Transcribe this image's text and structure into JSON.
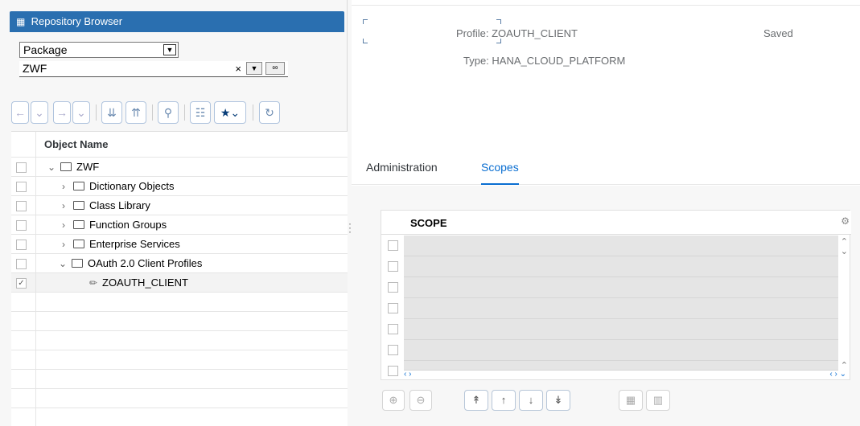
{
  "repo": {
    "title": "Repository Browser",
    "object_type": "Package",
    "package_value": "ZWF"
  },
  "tree": {
    "column_header": "Object Name",
    "rows": [
      {
        "label": "ZWF",
        "checked": false
      },
      {
        "label": "Dictionary Objects",
        "checked": false
      },
      {
        "label": "Class Library",
        "checked": false
      },
      {
        "label": "Function Groups",
        "checked": false
      },
      {
        "label": "Enterprise Services",
        "checked": false
      },
      {
        "label": "OAuth 2.0 Client Profiles",
        "checked": false
      },
      {
        "label": "ZOAUTH_CLIENT",
        "checked": true
      }
    ]
  },
  "profile": {
    "profile_label": "Profile:",
    "profile_value": "ZOAUTH_CLIENT",
    "type_label": "Type:",
    "type_value": "HANA_CLOUD_PLATFORM",
    "status": "Saved"
  },
  "tabs": [
    {
      "label": "Administration",
      "active": false
    },
    {
      "label": "Scopes",
      "active": true
    }
  ],
  "scopes": {
    "column_header": "SCOPE"
  },
  "colors": {
    "accent": "#0a6ed1",
    "header_blue": "#2a6fb0"
  }
}
